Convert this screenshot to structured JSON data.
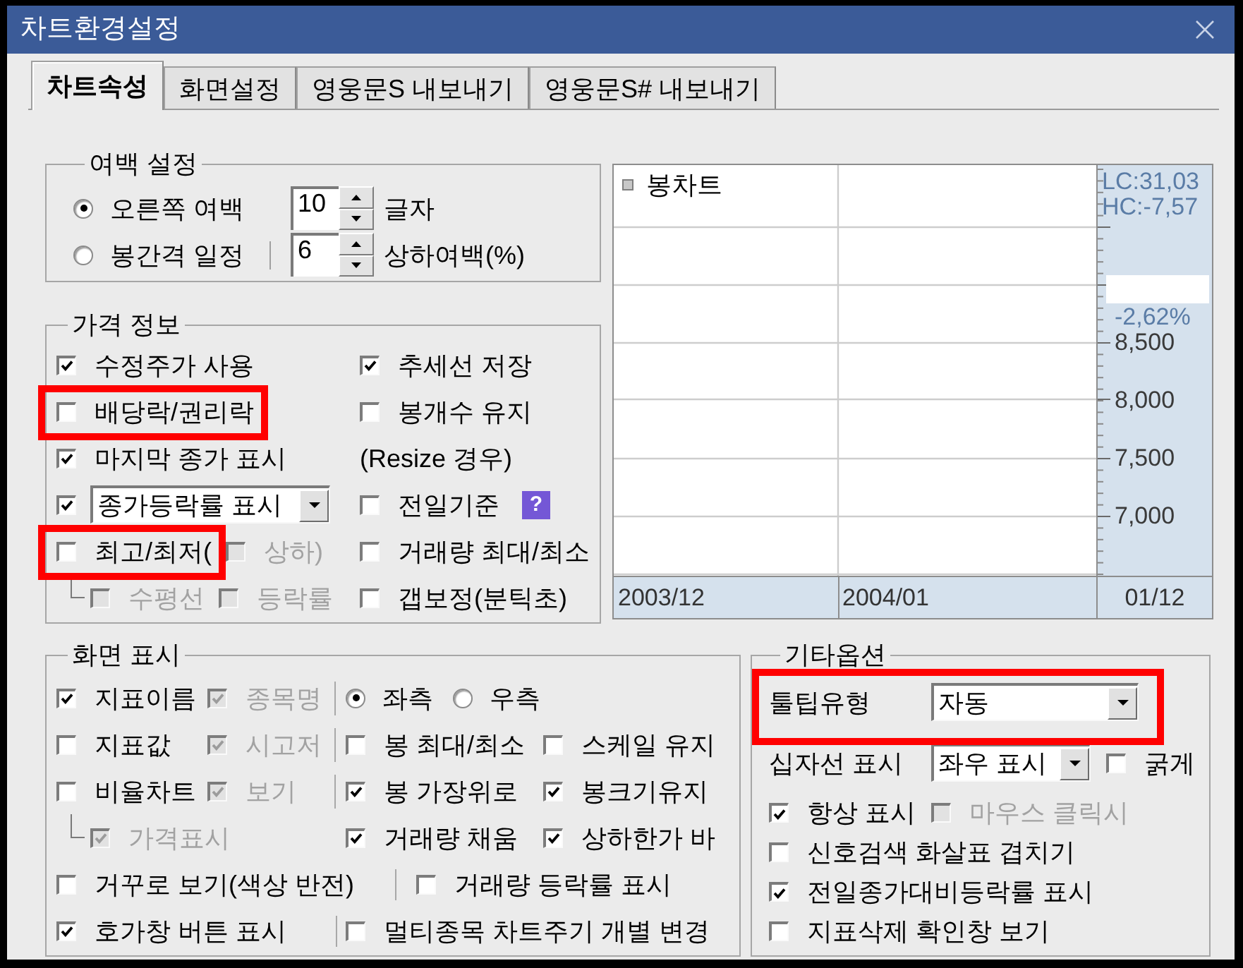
{
  "window": {
    "title": "차트환경설정"
  },
  "tabs": [
    {
      "label": "차트속성",
      "selected": true
    },
    {
      "label": "화면설정",
      "selected": false
    },
    {
      "label": "영웅문S 내보내기",
      "selected": false
    },
    {
      "label": "영웅문S# 내보내기",
      "selected": false
    }
  ],
  "margin_settings": {
    "title": "여백 설정",
    "options": [
      {
        "label": "오른쪽 여백",
        "selected": true,
        "value": "10",
        "unit": "글자"
      },
      {
        "label": "봉간격 일정",
        "selected": false,
        "value": "6",
        "unit": "상하여백(%)"
      }
    ]
  },
  "price_info": {
    "title": "가격 정보",
    "left": [
      {
        "items": [
          {
            "kind": "checkbox",
            "label": "수정주가 사용",
            "checked": true,
            "disabled": false
          }
        ]
      },
      {
        "items": [
          {
            "kind": "checkbox",
            "label": "배당락/권리락",
            "checked": false,
            "disabled": false,
            "highlighted": true
          }
        ]
      },
      {
        "items": [
          {
            "kind": "checkbox",
            "label": "마지막 종가 표시",
            "checked": true,
            "disabled": false
          }
        ]
      },
      {
        "items": [
          {
            "kind": "checkbox",
            "checked": true,
            "disabled": false
          },
          {
            "kind": "dropdown",
            "value": "종가등락률 표시"
          }
        ]
      },
      {
        "items": [
          {
            "kind": "checkbox",
            "label": "최고/최저(",
            "checked": false,
            "disabled": false,
            "highlighted": true
          },
          {
            "kind": "checkbox",
            "label": "상하)",
            "checked": false,
            "disabled": true
          }
        ],
        "children": [
          {
            "items": [
              {
                "kind": "checkbox",
                "label": "수평선",
                "checked": false,
                "disabled": true
              },
              {
                "kind": "checkbox",
                "label": "등락률",
                "checked": false,
                "disabled": true
              }
            ]
          }
        ]
      }
    ],
    "right": [
      {
        "items": [
          {
            "kind": "checkbox",
            "label": "추세선 저장",
            "checked": true,
            "disabled": false
          }
        ]
      },
      {
        "items": [
          {
            "kind": "checkbox",
            "label": "봉개수 유지",
            "checked": false,
            "disabled": false
          }
        ]
      },
      {
        "items": [
          {
            "kind": "text",
            "label": "(Resize 경우)"
          }
        ]
      },
      {
        "items": [
          {
            "kind": "checkbox",
            "label": "전일기준",
            "checked": false,
            "disabled": false
          },
          {
            "kind": "help",
            "label": "?"
          }
        ]
      },
      {
        "items": [
          {
            "kind": "checkbox",
            "label": "거래량 최대/최소",
            "checked": false,
            "disabled": false
          }
        ]
      },
      {
        "items": [
          {
            "kind": "checkbox",
            "label": "갭보정(분틱초)",
            "checked": false,
            "disabled": false
          }
        ]
      }
    ]
  },
  "chart_preview": {
    "legend": "봉차트",
    "info": [
      "LC:31,03",
      "HC:-7,57"
    ],
    "change": "-2,62%",
    "price_labels": [
      "8,500",
      "8,000",
      "7,500",
      "7,000"
    ],
    "date_labels": [
      "2003/12",
      "2004/01",
      "01/12"
    ]
  },
  "screen_display": {
    "title": "화면 표시",
    "left": [
      {
        "items": [
          {
            "kind": "checkbox",
            "label": "지표이름",
            "checked": true,
            "disabled": false
          },
          {
            "kind": "checkbox",
            "label": "종목명",
            "checked": true,
            "disabled": true
          }
        ]
      },
      {
        "items": [
          {
            "kind": "checkbox",
            "label": "지표값",
            "checked": false,
            "disabled": false
          },
          {
            "kind": "checkbox",
            "label": "시고저",
            "checked": true,
            "disabled": true
          }
        ]
      },
      {
        "items": [
          {
            "kind": "checkbox",
            "label": "비율차트",
            "checked": false,
            "disabled": false
          },
          {
            "kind": "checkbox",
            "label": "보기",
            "checked": true,
            "disabled": true
          }
        ],
        "children": [
          {
            "items": [
              {
                "kind": "checkbox",
                "label": "가격표시",
                "checked": true,
                "disabled": true
              }
            ]
          }
        ]
      }
    ],
    "right": [
      {
        "items": [
          {
            "kind": "radio",
            "label": "좌측",
            "selected": true
          },
          {
            "kind": "radio",
            "label": "우측",
            "selected": false
          }
        ]
      },
      {
        "items": [
          {
            "kind": "checkbox",
            "label": "봉 최대/최소",
            "checked": false,
            "disabled": false
          },
          {
            "kind": "checkbox",
            "label": "스케일 유지",
            "checked": false,
            "disabled": false
          }
        ]
      },
      {
        "items": [
          {
            "kind": "checkbox",
            "label": "봉 가장위로",
            "checked": true,
            "disabled": false
          },
          {
            "kind": "checkbox",
            "label": "봉크기유지",
            "checked": true,
            "disabled": false
          }
        ]
      },
      {
        "items": [
          {
            "kind": "checkbox",
            "label": "거래량 채움",
            "checked": true,
            "disabled": false
          },
          {
            "kind": "checkbox",
            "label": "상하한가 바",
            "checked": true,
            "disabled": false
          }
        ]
      }
    ],
    "rows": [
      {
        "left": [
          {
            "kind": "checkbox",
            "label": "거꾸로 보기(색상 반전)",
            "checked": false,
            "disabled": false
          }
        ],
        "right": [
          {
            "kind": "checkbox",
            "label": "거래량 등락률 표시",
            "checked": false,
            "disabled": false
          }
        ]
      },
      {
        "left": [
          {
            "kind": "checkbox",
            "label": "호가창 버튼 표시",
            "checked": true,
            "disabled": false
          }
        ],
        "right": [
          {
            "kind": "checkbox",
            "label": "멀티종목 차트주기 개별 변경",
            "checked": false,
            "disabled": false
          }
        ]
      }
    ]
  },
  "other_options": {
    "title": "기타옵션",
    "lines": [
      {
        "highlighted": true,
        "items": [
          {
            "kind": "text",
            "label": "툴팁유형"
          },
          {
            "kind": "dropdown",
            "value": "자동"
          }
        ]
      },
      {
        "items": [
          {
            "kind": "text",
            "label": "십자선 표시"
          },
          {
            "kind": "dropdown",
            "value": "좌우 표시"
          },
          {
            "kind": "checkbox",
            "label": "굵게",
            "checked": false,
            "disabled": false
          }
        ]
      },
      {
        "items": [
          {
            "kind": "checkbox",
            "label": "항상 표시",
            "checked": true,
            "disabled": false
          },
          {
            "kind": "checkbox",
            "label": "마우스 클릭시",
            "checked": false,
            "disabled": true
          }
        ]
      },
      {
        "items": [
          {
            "kind": "checkbox",
            "label": "신호검색 화살표 겹치기",
            "checked": false,
            "disabled": false
          }
        ]
      },
      {
        "items": [
          {
            "kind": "checkbox",
            "label": "전일종가대비등락률 표시",
            "checked": true,
            "disabled": false
          }
        ]
      },
      {
        "items": [
          {
            "kind": "checkbox",
            "label": "지표삭제 확인창 보기",
            "checked": false,
            "disabled": false
          }
        ]
      }
    ]
  }
}
